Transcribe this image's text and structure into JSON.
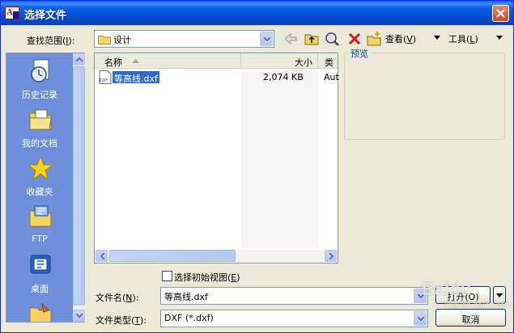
{
  "window": {
    "title": "选择文件"
  },
  "lookin": {
    "label_text": "查找范围",
    "label_key": "I",
    "folder": "设计",
    "views_label": "查看",
    "views_key": "V",
    "tools_label": "工具",
    "tools_key": "L"
  },
  "places": [
    {
      "label": "历史记录",
      "icon": "history-icon"
    },
    {
      "label": "我的文档",
      "icon": "my-documents-icon"
    },
    {
      "label": "收藏夹",
      "icon": "favorites-icon"
    },
    {
      "label": "FTP",
      "icon": "ftp-icon"
    },
    {
      "label": "桌面",
      "icon": "desktop-icon"
    }
  ],
  "filelist": {
    "columns": [
      "名称",
      "大小",
      "类"
    ],
    "files": [
      {
        "name": "等高线.dxf",
        "size": "2,074 KB",
        "type": "Aut",
        "icon": "dxf-file-icon"
      }
    ]
  },
  "preview": {
    "title": "预览"
  },
  "initial_view": {
    "label_text": "选择初始视图",
    "label_key": "E",
    "checked": false
  },
  "filename": {
    "label_text": "文件名",
    "label_key": "N",
    "value": "等高线.dxf"
  },
  "filetype": {
    "label_text": "文件类型",
    "label_key": "T",
    "value": "DXF (*.dxf)"
  },
  "buttons": {
    "open": "打开(O)",
    "cancel": "取消"
  },
  "watermark": {
    "text": "Baidu",
    "sub": "jingyan.baidu.com"
  },
  "colors": {
    "title_bar": "#0a5de7",
    "places_bg": "#6f8edb",
    "selection": "#316ac5",
    "dialog_bg": "#ece9d8"
  }
}
